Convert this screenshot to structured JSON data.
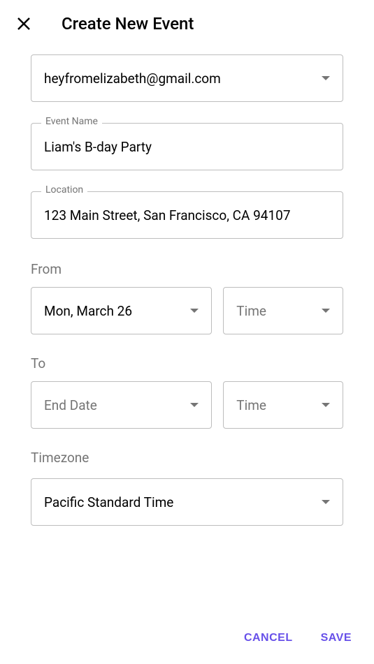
{
  "header": {
    "title": "Create New Event"
  },
  "fields": {
    "email": {
      "value": "heyfromelizabeth@gmail.com"
    },
    "event_name": {
      "label": "Event Name",
      "value": "Liam's B-day Party"
    },
    "location": {
      "label": "Location",
      "value": "123 Main Street, San Francisco, CA 94107"
    },
    "from": {
      "label": "From",
      "date_value": "Mon, March 26",
      "time_placeholder": "Time"
    },
    "to": {
      "label": "To",
      "date_placeholder": "End Date",
      "time_placeholder": "Time"
    },
    "timezone": {
      "label": "Timezone",
      "value": "Pacific Standard Time"
    }
  },
  "footer": {
    "cancel": "CANCEL",
    "save": "SAVE"
  }
}
